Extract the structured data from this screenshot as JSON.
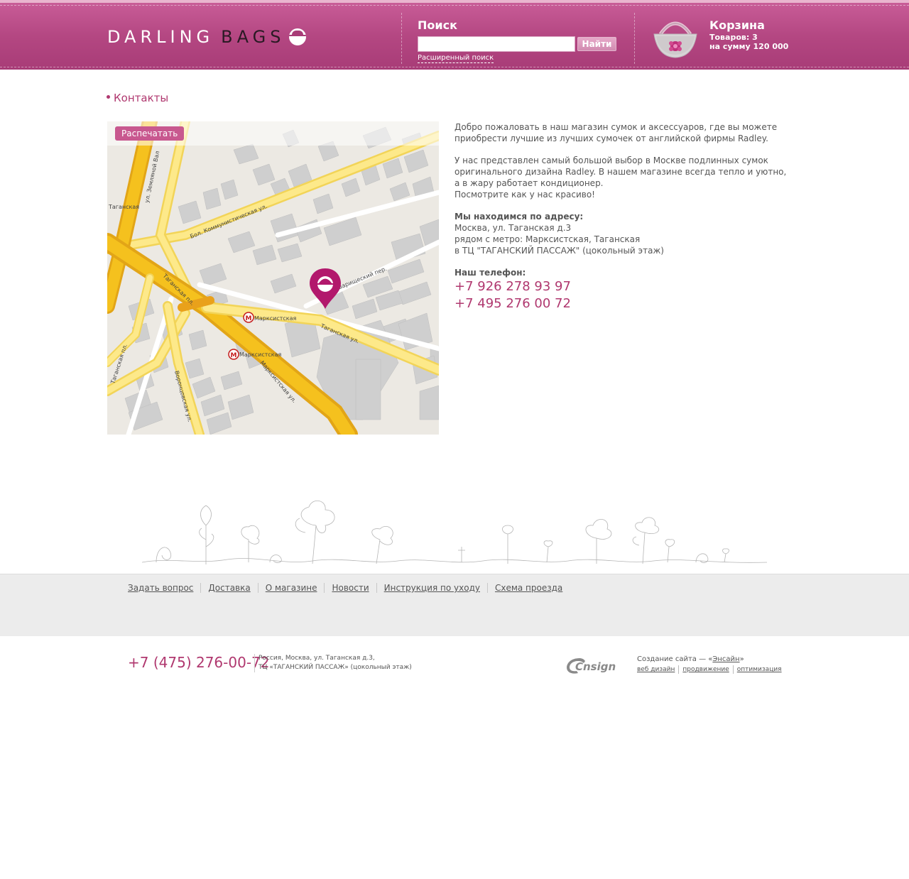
{
  "header": {
    "brand_word1": "DARLING",
    "brand_word2": "BAGS",
    "search": {
      "title": "Поиск",
      "input_value": "",
      "button_label": "Найти",
      "advanced_link": "Расширенный поиск"
    },
    "cart": {
      "title": "Корзина",
      "items_line": "Товаров: 3",
      "sum_line": "на сумму 120 000"
    }
  },
  "breadcrumb": {
    "current": "Контакты"
  },
  "map": {
    "print_label": "Распечатать",
    "labels": {
      "st_taganskaya": "Таганская ул.",
      "bol_kommun": "Бол. Коммунистическая ул.",
      "zemlyanoi_val": "ул. Земляной Вал",
      "taganskaya_pl": "Таганская пл.",
      "marksistskaya_ul": "Марксистская ул.",
      "marksistskaya_metro": "Марксистская",
      "marksistskaya_metro2": "Марксистская",
      "voronczovskaya": "Воронцовская ул.",
      "tovarishchesky": "Товарищеский пер.",
      "taganskaya_left": "Таганская",
      "taganskaya_pl2": "Таганская пл."
    }
  },
  "content": {
    "p1": "Добро пожаловать в наш магазин сумок и аксессуаров, где вы можете приобрести лучшие из лучших сумочек от английской фирмы Radley.",
    "p2_line1": "У нас представлен самый большой выбор в Москве подлинных сумок оригинального дизайна Radley. В нашем магазине всегда тепло и уютно, а в жару работает кондиционер.",
    "p2_line2": "Посмотрите как у нас красиво!",
    "address_label": "Мы находимся по адресу:",
    "address_line1": "Москва, ул. Таганская д.3",
    "address_line2": "рядом с метро: Марксистская, Таганская",
    "address_line3": "в ТЦ \"ТАГАНСКИЙ ПАССАЖ\" (цокольный этаж)",
    "phone_label": "Наш телефон:",
    "phone1": "+7 926 278 93 97",
    "phone2": "+7 495 276 00 72"
  },
  "footer_nav": [
    "Задать вопрос",
    "Доставка",
    "О магазине",
    "Новости",
    "Инструкция по уходу",
    "Схема проезда"
  ],
  "footer": {
    "phone": "+7 (475) 276-00-72",
    "addr_line1": "Россия, Москва, ул. Таганская д.3,",
    "addr_line2": "ТЦ «ТАГАНСКИЙ ПАССАЖ» (цокольный этаж)",
    "ensign_logo_text": "Cnsign",
    "ensign_prefix": "Создание сайта — «",
    "ensign_name": "Энсайн",
    "ensign_suffix": "»",
    "ensign_links": [
      "веб дизайн",
      "продвижение",
      "оптимизация"
    ]
  },
  "colors": {
    "brand": "#b44782",
    "accent_text": "#b0386f"
  }
}
